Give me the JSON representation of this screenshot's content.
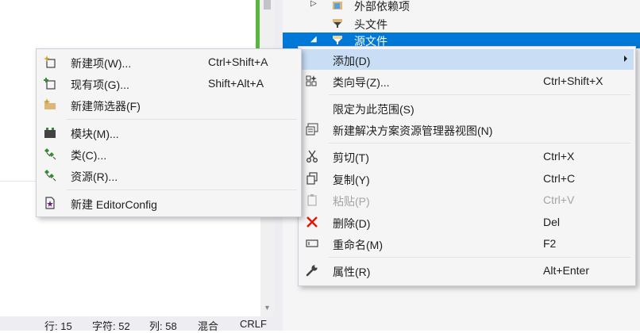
{
  "tree": {
    "items": [
      {
        "label": "外部依赖项",
        "icon": "external-dependencies-icon",
        "chevron": "▷"
      },
      {
        "label": "头文件",
        "icon": "filter-folder-icon",
        "chevron": ""
      },
      {
        "label": "源文件",
        "icon": "filter-folder-icon",
        "chevron": "◢"
      }
    ]
  },
  "left_menu": {
    "items": [
      {
        "label": "新建项(W)...",
        "shortcut": "Ctrl+Shift+A",
        "icon": "new-item-icon"
      },
      {
        "label": "现有项(G)...",
        "shortcut": "Shift+Alt+A",
        "icon": "existing-item-icon"
      },
      {
        "label": "新建筛选器(F)",
        "shortcut": "",
        "icon": "new-filter-icon"
      },
      {
        "label": "模块(M)...",
        "shortcut": "",
        "icon": "module-icon"
      },
      {
        "label": "类(C)...",
        "shortcut": "",
        "icon": "class-icon"
      },
      {
        "label": "资源(R)...",
        "shortcut": "",
        "icon": "resource-icon"
      },
      {
        "label": "新建 EditorConfig",
        "shortcut": "",
        "icon": "editorconfig-icon"
      }
    ]
  },
  "right_menu": {
    "items": [
      {
        "label": "添加(D)",
        "shortcut": "",
        "icon": ""
      },
      {
        "label": "类向导(Z)...",
        "shortcut": "Ctrl+Shift+X",
        "icon": "class-wizard-icon"
      },
      {
        "label": "限定为此范围(S)",
        "shortcut": "",
        "icon": ""
      },
      {
        "label": "新建解决方案资源管理器视图(N)",
        "shortcut": "",
        "icon": "new-view-icon"
      },
      {
        "label": "剪切(T)",
        "shortcut": "Ctrl+X",
        "icon": "cut-icon"
      },
      {
        "label": "复制(Y)",
        "shortcut": "Ctrl+C",
        "icon": "copy-icon"
      },
      {
        "label": "粘贴(P)",
        "shortcut": "Ctrl+V",
        "icon": "paste-icon"
      },
      {
        "label": "删除(D)",
        "shortcut": "Del",
        "icon": "delete-icon"
      },
      {
        "label": "重命名(M)",
        "shortcut": "F2",
        "icon": "rename-icon"
      },
      {
        "label": "属性(R)",
        "shortcut": "Alt+Enter",
        "icon": "wrench-icon"
      }
    ]
  },
  "status": {
    "line": "行: 15",
    "char": "字符: 52",
    "col": "列: 58",
    "mode": "混合",
    "eol": "CRLF"
  },
  "colors": {
    "selection": "#0078d7",
    "menu_highlight": "#c9def5",
    "delete_red": "#e51400",
    "change_bar": "#56b83c"
  }
}
